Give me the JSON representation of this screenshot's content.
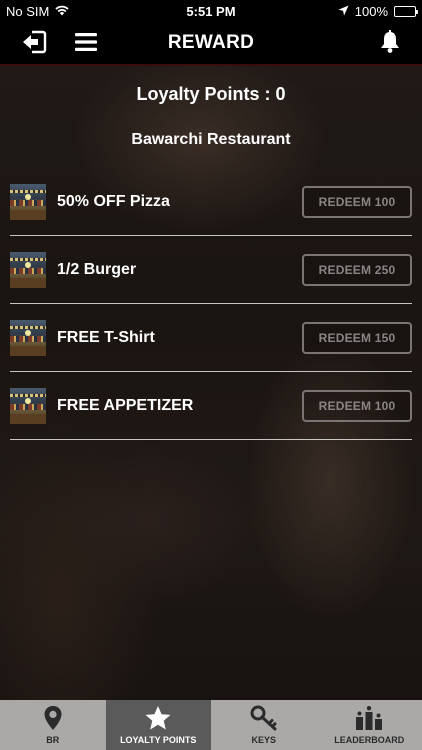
{
  "status_bar": {
    "carrier": "No SIM",
    "time": "5:51 PM",
    "battery": "100%"
  },
  "header": {
    "title": "REWARD",
    "icons": [
      "logout-icon",
      "menu-icon",
      "bell-icon"
    ]
  },
  "loyalty_points": "Loyalty Points : 0",
  "restaurant": "Bawarchi Restaurant",
  "rewards": [
    {
      "label": "50% OFF Pizza",
      "button": "REDEEM 100"
    },
    {
      "label": "1/2 Burger",
      "button": "REDEEM 250"
    },
    {
      "label": "FREE T-Shirt",
      "button": "REDEEM 150"
    },
    {
      "label": "FREE APPETIZER",
      "button": "REDEEM 100"
    }
  ],
  "tabs": [
    {
      "label": "BR",
      "icon": "map-pin-icon",
      "active": false
    },
    {
      "label": "LOYALTY POINTS",
      "icon": "star-icon",
      "active": true
    },
    {
      "label": "KEYS",
      "icon": "key-icon",
      "active": false
    },
    {
      "label": "LEADERBOARD",
      "icon": "leaderboard-icon",
      "active": false
    }
  ],
  "colors": {
    "header_bg": "#000000",
    "button_border": "#7a7574",
    "tabbar_bg": "#aaa9a7",
    "tab_active_bg": "#5a5a5a"
  }
}
